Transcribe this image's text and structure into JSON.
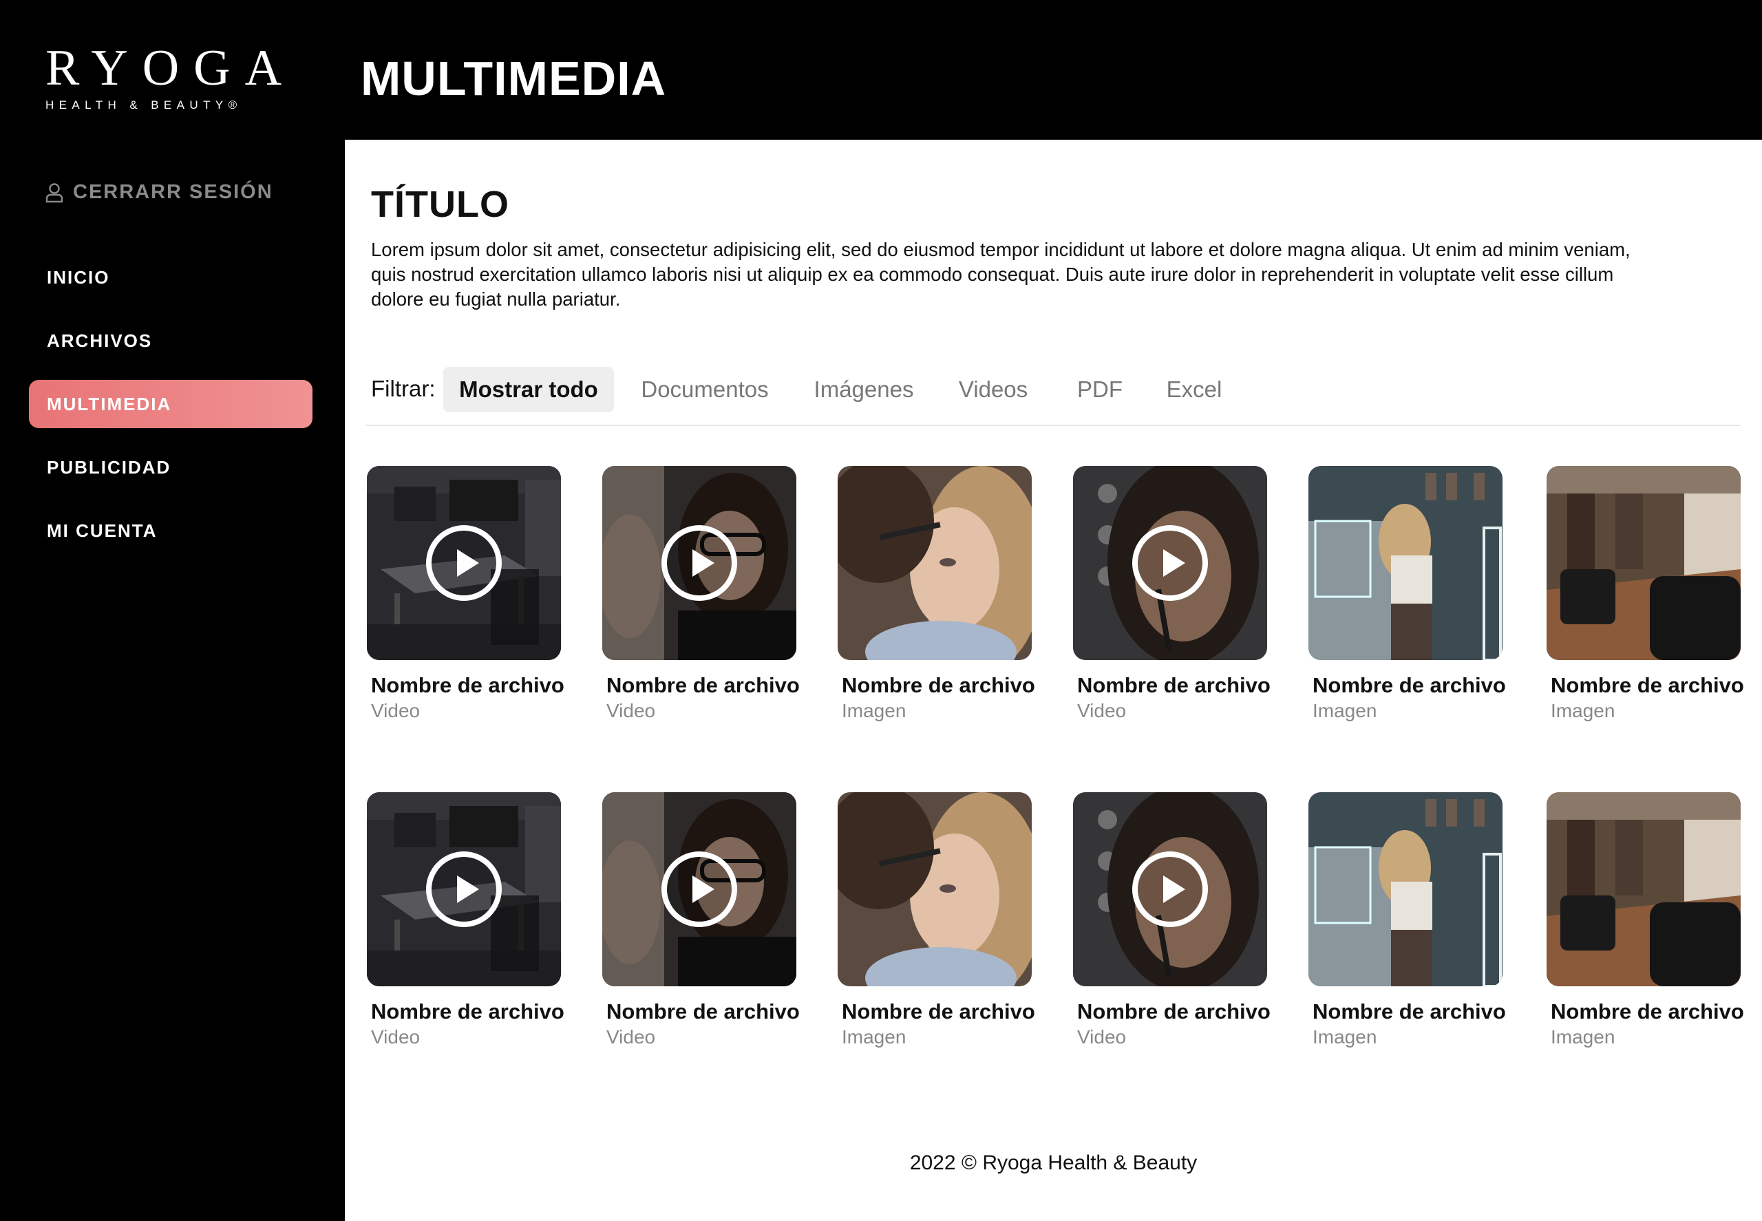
{
  "brand": {
    "name": "RYOGA",
    "tagline": "HEALTH & BEAUTY®"
  },
  "header": {
    "title": "MULTIMEDIA"
  },
  "sidebar": {
    "logout_label": "CERRARR SESIÓN",
    "items": [
      {
        "label": "INICIO",
        "active": false
      },
      {
        "label": "ARCHIVOS",
        "active": false
      },
      {
        "label": "MULTIMEDIA",
        "active": true
      },
      {
        "label": "PUBLICIDAD",
        "active": false
      },
      {
        "label": "MI CUENTA",
        "active": false
      }
    ]
  },
  "content": {
    "title": "TÍTULO",
    "description": "Lorem ipsum dolor sit amet, consectetur adipisicing elit, sed do eiusmod tempor incididunt ut labore et dolore magna aliqua. Ut enim ad minim veniam, quis nostrud exercitation ullamco laboris nisi ut aliquip ex ea commodo consequat. Duis aute irure dolor in reprehenderit in voluptate velit esse cillum dolore eu fugiat nulla pariatur."
  },
  "filter": {
    "label": "Filtrar:",
    "tabs": [
      {
        "label": "Mostrar todo",
        "active": true
      },
      {
        "label": "Documentos",
        "active": false
      },
      {
        "label": "Imágenes",
        "active": false
      },
      {
        "label": "Videos",
        "active": false
      },
      {
        "label": "PDF",
        "active": false
      },
      {
        "label": "Excel",
        "active": false
      }
    ]
  },
  "media_rows": [
    [
      {
        "name": "Nombre de archivo",
        "type": "Video",
        "thumb": "studio"
      },
      {
        "name": "Nombre de archivo",
        "type": "Video",
        "thumb": "artist"
      },
      {
        "name": "Nombre de archivo",
        "type": "Imagen",
        "thumb": "bride"
      },
      {
        "name": "Nombre de archivo",
        "type": "Video",
        "thumb": "portrait"
      },
      {
        "name": "Nombre de archivo",
        "type": "Imagen",
        "thumb": "mirror"
      },
      {
        "name": "Nombre de archivo",
        "type": "Imagen",
        "thumb": "salon"
      }
    ],
    [
      {
        "name": "Nombre de archivo",
        "type": "Video",
        "thumb": "studio"
      },
      {
        "name": "Nombre de archivo",
        "type": "Video",
        "thumb": "artist"
      },
      {
        "name": "Nombre de archivo",
        "type": "Imagen",
        "thumb": "bride"
      },
      {
        "name": "Nombre de archivo",
        "type": "Video",
        "thumb": "portrait"
      },
      {
        "name": "Nombre de archivo",
        "type": "Imagen",
        "thumb": "mirror"
      },
      {
        "name": "Nombre de archivo",
        "type": "Imagen",
        "thumb": "salon"
      }
    ]
  ],
  "footer": {
    "text": "2022 © Ryoga Health & Beauty"
  },
  "colors": {
    "accent": "#e87476",
    "background": "#000000",
    "panel": "#ffffff"
  }
}
